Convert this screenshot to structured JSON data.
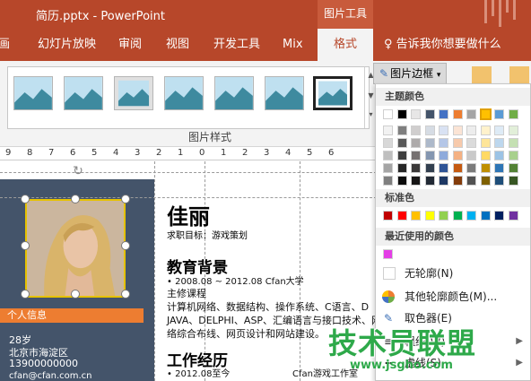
{
  "titlebar": {
    "title": "简历.pptx  -  PowerPoint",
    "contextual_tab": "图片工具"
  },
  "tabs": [
    {
      "label": "画"
    },
    {
      "label": "幻灯片放映"
    },
    {
      "label": "审阅"
    },
    {
      "label": "视图"
    },
    {
      "label": "开发工具"
    },
    {
      "label": "Mix"
    },
    {
      "label": "格式"
    }
  ],
  "tellme": "♀ 告诉我你想要做什么",
  "ribbon": {
    "group_label": "图片样式",
    "picture_border_button": "图片边框",
    "picture_border_icon": "pen-icon",
    "thumbs_count_label": "7"
  },
  "ruler": {
    "ticks": [
      "9",
      "8",
      "7",
      "6",
      "5",
      "4",
      "3",
      "2",
      "1",
      "0",
      "1",
      "2",
      "3",
      "4",
      "5",
      "6"
    ]
  },
  "slide": {
    "name": "佳丽",
    "objective": "求职目标：游戏策划",
    "section_edu": "教育背景",
    "edu_line": "•   2008.08 ~ 2012.08 Cfan大学",
    "edu_course": "主修课程",
    "edu_body1": "计算机网络、数据结构、操作系统、C语言、D",
    "edu_body2": "JAVA、DELPHI、ASP、汇编语言与接口技术、网",
    "edu_body3": "络综合布线、网页设计和网站建设。",
    "section_work": "工作经历",
    "work_line": "•   2012.08至今",
    "work_company": "Cfan游戏工作室",
    "sidebar_title": "个人信息",
    "age": "28岁",
    "location": "北京市海淀区",
    "phone": "13900000000",
    "email": "cfan@cfan.com.cn"
  },
  "dropdown": {
    "theme_colors_label": "主题颜色",
    "standard_colors_label": "标准色",
    "recent_colors_label": "最近使用的颜色",
    "no_outline": "无轮廓(N)",
    "more_colors": "其他轮廓颜色(M)...",
    "eyedropper": "取色器(E)",
    "weight": "粗细(W)",
    "dashes": "虚线(S)",
    "theme_top_row": [
      "#ffffff",
      "#000000",
      "#e7e6e6",
      "#44546a",
      "#4472c4",
      "#ed7d31",
      "#a5a5a5",
      "#ffc000",
      "#5b9bd5",
      "#70ad47"
    ],
    "theme_shades": [
      [
        "#f2f2f2",
        "#7f7f7f",
        "#d0cece",
        "#d6dce4",
        "#d9e2f3",
        "#fbe4d5",
        "#ededed",
        "#fff2cc",
        "#deebf6",
        "#e2efd9"
      ],
      [
        "#d8d8d8",
        "#595959",
        "#aeabab",
        "#adb9ca",
        "#b4c6e7",
        "#f7caac",
        "#dbdbdb",
        "#fee599",
        "#bdd7ee",
        "#c5e0b3"
      ],
      [
        "#bfbfbf",
        "#3f3f3f",
        "#757070",
        "#8496b0",
        "#8eaadb",
        "#f4b183",
        "#c9c9c9",
        "#ffd965",
        "#9cc3e5",
        "#a8d08d"
      ],
      [
        "#a5a5a5",
        "#262626",
        "#3a3838",
        "#323f4f",
        "#2f5496",
        "#c55a11",
        "#7b7b7b",
        "#bf8f00",
        "#2e75b5",
        "#538135"
      ],
      [
        "#7f7f7f",
        "#0c0c0c",
        "#171616",
        "#222a35",
        "#1e3864",
        "#833c0b",
        "#525252",
        "#7f6000",
        "#1f4e79",
        "#375623"
      ]
    ],
    "standard": [
      "#c00000",
      "#ff0000",
      "#ffc000",
      "#ffff00",
      "#92d050",
      "#00b050",
      "#00b0f0",
      "#0070c0",
      "#002060",
      "#7030a0"
    ],
    "recent": [
      "#e43ee6"
    ],
    "selected_color": "#ffc000"
  },
  "watermark": {
    "text": "技术员联盟",
    "url": "www.jsgho.com"
  }
}
